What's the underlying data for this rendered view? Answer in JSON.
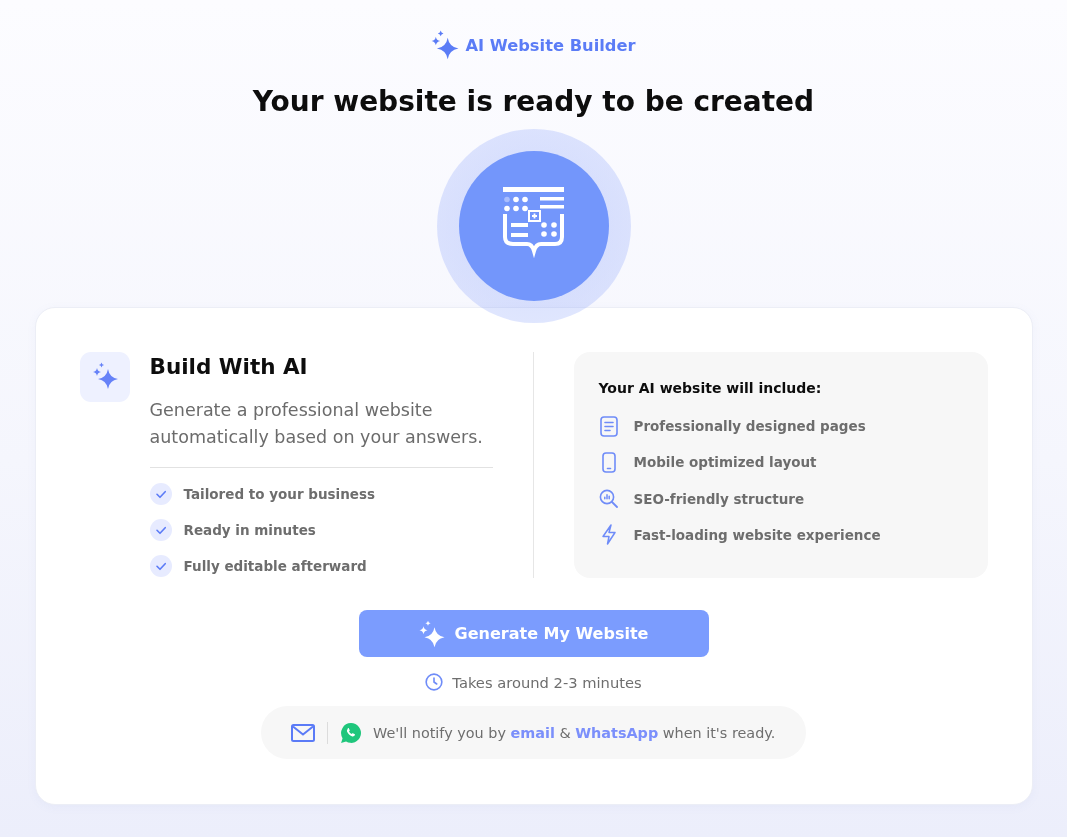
{
  "brand": {
    "name": "AI Website Builder"
  },
  "title": "Your website is ready to be created",
  "build": {
    "heading": "Build With AI",
    "description": "Generate a professional website automatically based on your answers.",
    "benefits": [
      {
        "label": "Tailored to your business"
      },
      {
        "label": "Ready in minutes"
      },
      {
        "label": "Fully editable afterward"
      }
    ]
  },
  "includes": {
    "heading": "Your AI website will include:",
    "items": [
      {
        "kind": "pages",
        "label": "Professionally designed pages"
      },
      {
        "kind": "mobile",
        "label": "Mobile optimized layout"
      },
      {
        "kind": "seo",
        "label": "SEO-friendly structure"
      },
      {
        "kind": "speed",
        "label": "Fast-loading website experience"
      }
    ]
  },
  "generate_button": {
    "label": "Generate My Website"
  },
  "duration": "Takes around 2-3 minutes",
  "notice": {
    "text": "We'll notify you by **email** & **WhatsApp** when it's ready."
  }
}
